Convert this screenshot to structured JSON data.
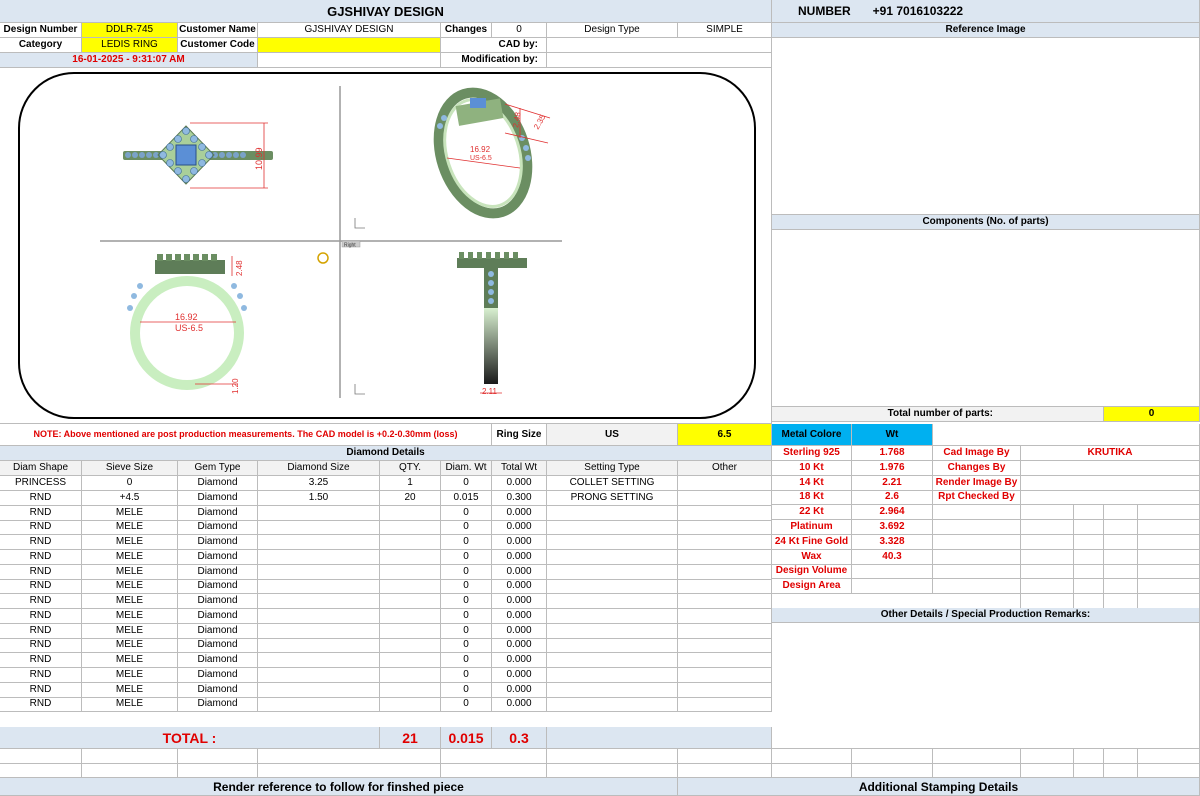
{
  "company": "GJSHIVAY DESIGN",
  "number_label": "NUMBER",
  "phone": "+91 7016103222",
  "header": {
    "design_number_label": "Design Number",
    "design_number": "DDLR-745",
    "customer_name_label": "Customer Name",
    "customer_name": "GJSHIVAY DESIGN",
    "changes_label": "Changes",
    "changes": "0",
    "design_type_label": "Design Type",
    "design_type": "SIMPLE",
    "category_label": "Category",
    "category": "LEDIS RING",
    "customer_code_label": "Customer Code",
    "customer_code": "",
    "cad_by_label": "CAD by:",
    "cad_by": "",
    "modification_by_label": "Modification by:",
    "modification_by": "",
    "datetime": "16-01-2025 - 9:31:07 AM"
  },
  "right": {
    "reference_image": "Reference Image",
    "components": "Components (No. of parts)",
    "total_parts_label": "Total number of parts:",
    "total_parts": "0",
    "metal_colore": "Metal Colore",
    "wt": "Wt",
    "metals": [
      {
        "name": "Sterling 925",
        "wt": "1.768"
      },
      {
        "name": "10 Kt",
        "wt": "1.976"
      },
      {
        "name": "14 Kt",
        "wt": "2.21"
      },
      {
        "name": "18 Kt",
        "wt": "2.6"
      },
      {
        "name": "22 Kt",
        "wt": "2.964"
      },
      {
        "name": "Platinum",
        "wt": "3.692"
      },
      {
        "name": "24 Kt Fine Gold",
        "wt": "3.328"
      },
      {
        "name": "Wax",
        "wt": "40.3"
      },
      {
        "name": "Design Volume",
        "wt": ""
      },
      {
        "name": "Design Area",
        "wt": ""
      }
    ],
    "credits": [
      {
        "label": "Cad Image By",
        "value": "KRUTIKA"
      },
      {
        "label": "Changes By",
        "value": ""
      },
      {
        "label": "Render Image By",
        "value": ""
      },
      {
        "label": "Rpt Checked By",
        "value": ""
      }
    ],
    "other_details": "Other Details / Special Production Remarks:",
    "additional_stamping": "Additional Stamping Details"
  },
  "cad": {
    "dims": {
      "h1": "10.99",
      "w2": "16.92",
      "us2": "US-6.5",
      "h2": "2.48",
      "h2b": "2.35",
      "w3": "16.92",
      "us3": "US-6.5",
      "h3": "2.48",
      "h3b": "1.20",
      "w4": "2.11"
    },
    "view_tag": "Right"
  },
  "note": "NOTE: Above mentioned are post production measurements. The CAD model is +0.2-0.30mm (loss)",
  "ring_size_label": "Ring Size",
  "ring_size_system": "US",
  "ring_size": "6.5",
  "diamond_details": "Diamond Details",
  "diamond_headers": [
    "Diam Shape",
    "Sieve Size",
    "Gem Type",
    "Diamond Size",
    "QTY.",
    "Diam. Wt",
    "Total Wt",
    "Setting Type",
    "Other"
  ],
  "diamond_rows": [
    [
      "PRINCESS",
      "0",
      "Diamond",
      "3.25",
      "1",
      "0",
      "0.000",
      "COLLET SETTING",
      ""
    ],
    [
      "RND",
      "+4.5",
      "Diamond",
      "1.50",
      "20",
      "0.015",
      "0.300",
      "PRONG SETTING",
      ""
    ],
    [
      "RND",
      "MELE",
      "Diamond",
      "",
      "",
      "0",
      "0.000",
      "",
      ""
    ],
    [
      "RND",
      "MELE",
      "Diamond",
      "",
      "",
      "0",
      "0.000",
      "",
      ""
    ],
    [
      "RND",
      "MELE",
      "Diamond",
      "",
      "",
      "0",
      "0.000",
      "",
      ""
    ],
    [
      "RND",
      "MELE",
      "Diamond",
      "",
      "",
      "0",
      "0.000",
      "",
      ""
    ],
    [
      "RND",
      "MELE",
      "Diamond",
      "",
      "",
      "0",
      "0.000",
      "",
      ""
    ],
    [
      "RND",
      "MELE",
      "Diamond",
      "",
      "",
      "0",
      "0.000",
      "",
      ""
    ],
    [
      "RND",
      "MELE",
      "Diamond",
      "",
      "",
      "0",
      "0.000",
      "",
      ""
    ],
    [
      "RND",
      "MELE",
      "Diamond",
      "",
      "",
      "0",
      "0.000",
      "",
      ""
    ],
    [
      "RND",
      "MELE",
      "Diamond",
      "",
      "",
      "0",
      "0.000",
      "",
      ""
    ],
    [
      "RND",
      "MELE",
      "Diamond",
      "",
      "",
      "0",
      "0.000",
      "",
      ""
    ],
    [
      "RND",
      "MELE",
      "Diamond",
      "",
      "",
      "0",
      "0.000",
      "",
      ""
    ],
    [
      "RND",
      "MELE",
      "Diamond",
      "",
      "",
      "0",
      "0.000",
      "",
      ""
    ],
    [
      "RND",
      "MELE",
      "Diamond",
      "",
      "",
      "0",
      "0.000",
      "",
      ""
    ],
    [
      "RND",
      "MELE",
      "Diamond",
      "",
      "",
      "0",
      "0.000",
      "",
      ""
    ]
  ],
  "totals": {
    "label": "TOTAL :",
    "qty": "21",
    "diam_wt": "0.015",
    "total_wt": "0.3"
  },
  "render_reference": "Render reference to follow for finshed piece"
}
